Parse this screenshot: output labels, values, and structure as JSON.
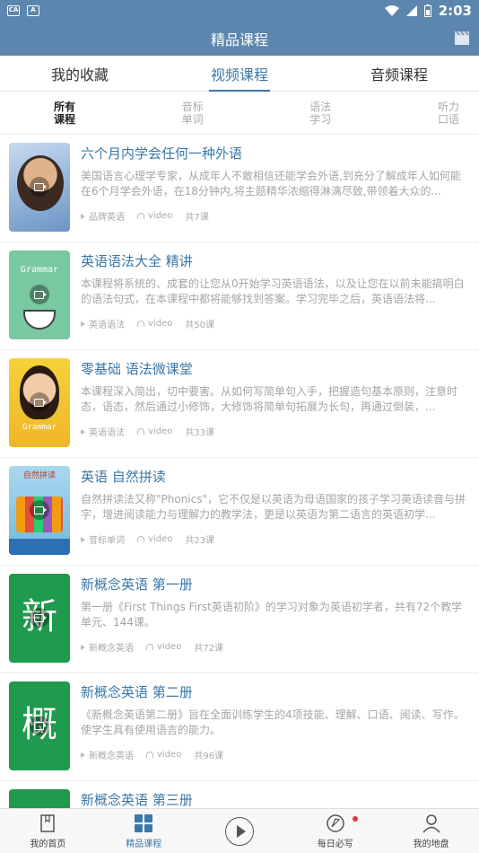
{
  "status": {
    "time": "2:03"
  },
  "header": {
    "title": "精品课程"
  },
  "tabs": [
    {
      "label": "我的收藏"
    },
    {
      "label": "视频课程",
      "active": true
    },
    {
      "label": "音频课程"
    }
  ],
  "filters": [
    {
      "label": "所有课程",
      "active": true
    },
    {
      "label": "音标单词"
    },
    {
      "label": "语法学习"
    },
    {
      "label": "听力口语"
    }
  ],
  "courses": [
    {
      "title": "六个月内学会任何一种外语",
      "desc": "美国语言心理学专家，从成年人不敢相信还能学会外语,到充分了解成年人如何能在6个月学会外语，在18分钟内,将主题精华浓缩得淋漓尽致,带领着大众的...",
      "category": "品牌英语",
      "type": "video",
      "count": "共7课"
    },
    {
      "title": "英语语法大全 精讲",
      "desc": "本课程将系统的、成套的让您从0开始学习英语语法，以及让您在以前未能搞明白的语法句式，在本课程中都将能够找到答案。学习完毕之后，英语语法将...",
      "category": "英语语法",
      "type": "video",
      "count": "共50课"
    },
    {
      "title": "零基础 语法微课堂",
      "desc": "本课程深入简出，切中要害。从如何写简单句入手，把握造句基本原则，注意时态，语态，然后通过小修饰，大修饰将简单句拓展为长句，再通过倒装，...",
      "category": "英语语法",
      "type": "video",
      "count": "共33课"
    },
    {
      "title": "英语 自然拼读",
      "desc": "自然拼读法又称\"Phonics\"，它不仅是以英语为母语国家的孩子学习英语读音与拼字，增进阅读能力与理解力的教学法，更是以英语为第二语言的英语初学...",
      "category": "音标单词",
      "type": "video",
      "count": "共23课"
    },
    {
      "title": "新概念英语 第一册",
      "desc": "第一册《First Things First英语初阶》的学习对象为英语初学者，共有72个教学单元、144课。",
      "category": "新概念英语",
      "type": "video",
      "count": "共72课"
    },
    {
      "title": "新概念英语 第二册",
      "desc": "《新概念英语第二册》旨在全面训练学生的4项技能、理解、口语、阅读、写作。使学生具有使用语言的能力。",
      "category": "新概念英语",
      "type": "video",
      "count": "共96课"
    },
    {
      "title": "新概念英语 第三册"
    }
  ],
  "thumbs": {
    "t2": "Grammar",
    "t3": "Grammar",
    "t4": "自然拼读",
    "t5a": "新",
    "t5b": "概"
  },
  "bottom_nav": [
    {
      "label": "我的首页"
    },
    {
      "label": "精品课程",
      "active": true
    },
    {
      "label": ""
    },
    {
      "label": "每日必写"
    },
    {
      "label": "我的地盘"
    }
  ],
  "colors": {
    "primary": "#5c86ad",
    "accent": "#3a78a8",
    "badge": "#e53935"
  }
}
